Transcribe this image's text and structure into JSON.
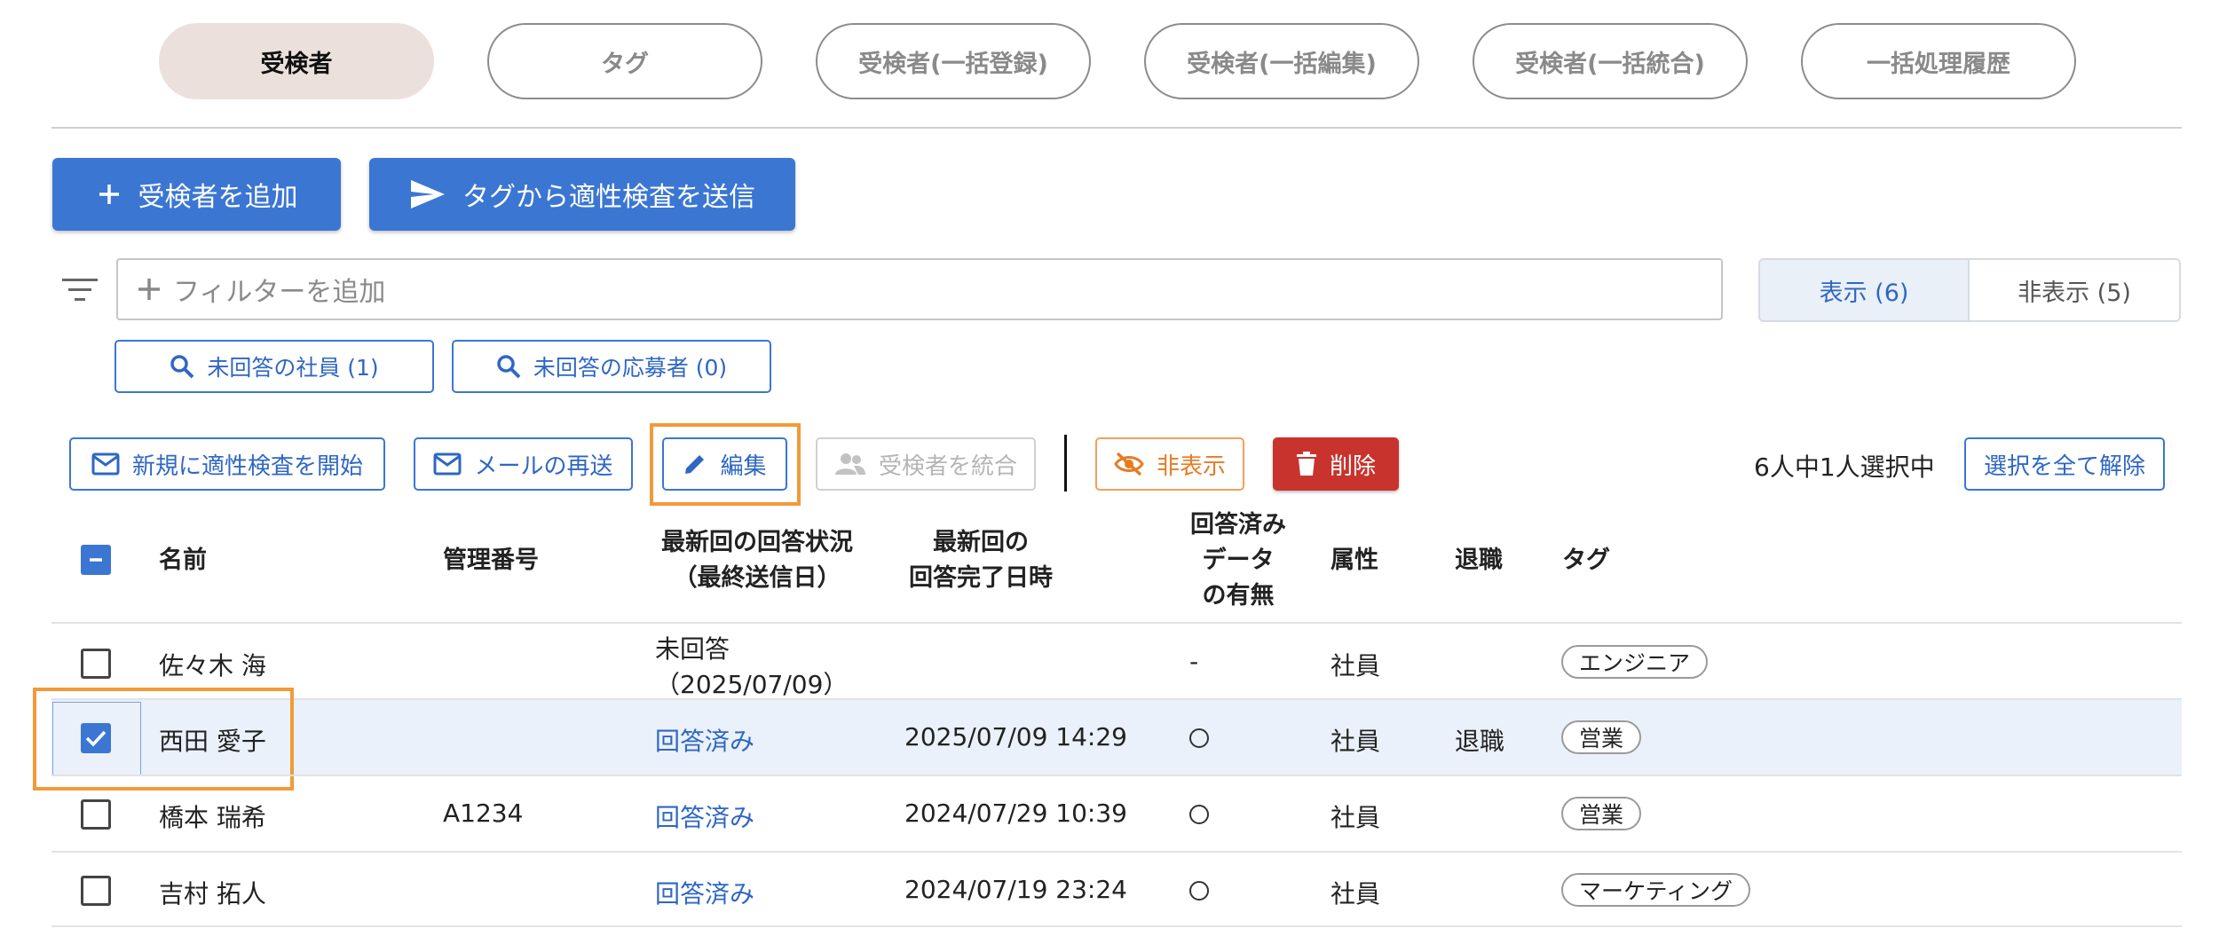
{
  "tabs": [
    {
      "label": "受検者",
      "active": true
    },
    {
      "label": "タグ",
      "active": false
    },
    {
      "label": "受検者(一括登録)",
      "active": false
    },
    {
      "label": "受検者(一括編集)",
      "active": false
    },
    {
      "label": "受検者(一括統合)",
      "active": false
    },
    {
      "label": "一括処理履歴",
      "active": false
    }
  ],
  "actions": {
    "add_examinee": "受検者を追加",
    "send_from_tag": "タグから適性検査を送信"
  },
  "filter": {
    "placeholder": "フィルターを追加",
    "visible": "表示 (6)",
    "hidden": "非表示 (5)",
    "quick_unanswered_employees": "未回答の社員 (1)",
    "quick_unanswered_applicants": "未回答の応募者 (0)"
  },
  "toolbar": {
    "start_new_test": "新規に適性検査を開始",
    "resend_mail": "メールの再送",
    "edit": "編集",
    "merge": "受検者を統合",
    "hide": "非表示",
    "delete": "削除",
    "selection_status": "6人中1人選択中",
    "clear_selection": "選択を全て解除"
  },
  "table": {
    "headers": {
      "name": "名前",
      "management_number": "管理番号",
      "latest_status_line1": "最新回の回答状況",
      "latest_status_line2": "（最終送信日）",
      "latest_completed_line1": "最新回の",
      "latest_completed_line2": "回答完了日時",
      "has_data_line1": "回答済み",
      "has_data_line2": "データ",
      "has_data_line3": "の有無",
      "attribute": "属性",
      "retired": "退職",
      "tags": "タグ"
    },
    "rows": [
      {
        "name": "佐々木 海",
        "management_number": "",
        "status": "未回答",
        "status_sub": "（2025/07/09）",
        "completed_at": "",
        "has_data": "-",
        "attribute": "社員",
        "retired": "",
        "tag": "エンジニア",
        "checked": false
      },
      {
        "name": "西田 愛子",
        "management_number": "",
        "status": "回答済み",
        "status_sub": "",
        "completed_at": "2025/07/09 14:29",
        "has_data": "○",
        "attribute": "社員",
        "retired": "退職",
        "tag": "営業",
        "checked": true
      },
      {
        "name": "橋本 瑞希",
        "management_number": "A1234",
        "status": "回答済み",
        "status_sub": "",
        "completed_at": "2024/07/29 10:39",
        "has_data": "○",
        "attribute": "社員",
        "retired": "",
        "tag": "営業",
        "checked": false
      },
      {
        "name": "吉村 拓人",
        "management_number": "",
        "status": "回答済み",
        "status_sub": "",
        "completed_at": "2024/07/19 23:24",
        "has_data": "○",
        "attribute": "社員",
        "retired": "",
        "tag": "マーケティング",
        "checked": false
      }
    ]
  },
  "colors": {
    "primary": "#3b76d3",
    "danger": "#c8332e",
    "warning": "#e67b25",
    "highlight": "#f29a38",
    "active_tab": "#ebe0dc"
  }
}
